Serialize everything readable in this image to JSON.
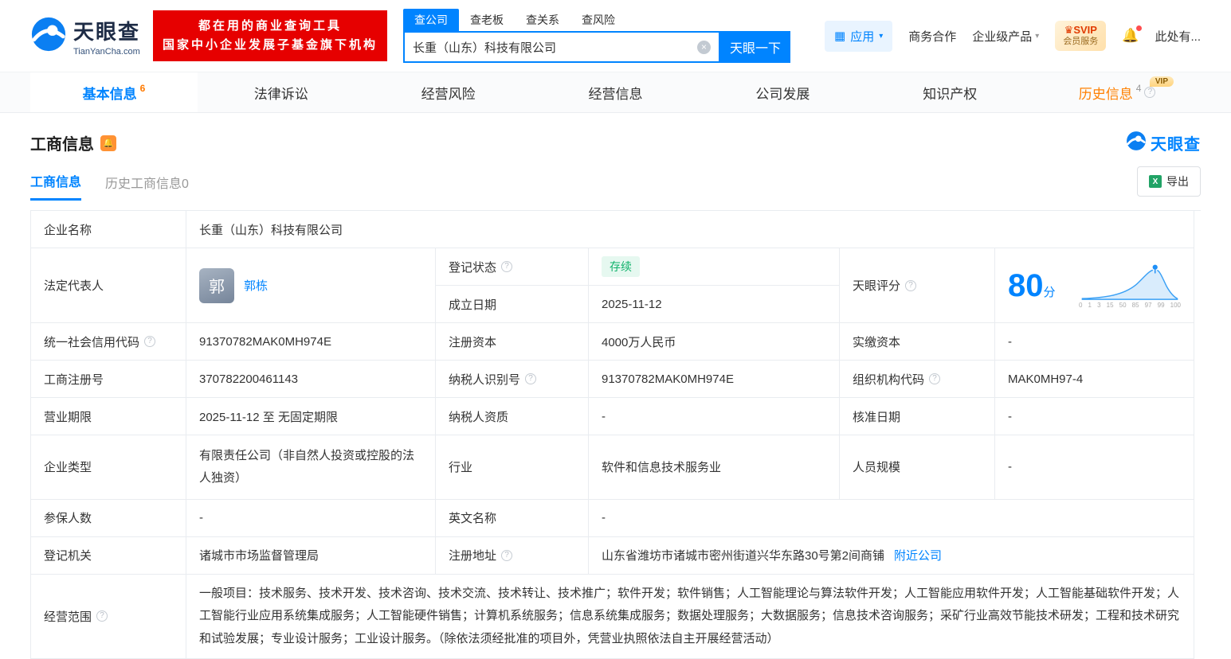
{
  "icons": {
    "clear": "×",
    "caret": "▾",
    "grid": "▦",
    "bell": "🔔",
    "crown": "♛",
    "excel": "X",
    "question": "?"
  },
  "brand": {
    "name": "天眼查",
    "domain": "TianYanCha.com"
  },
  "header": {
    "banner_line1": "都在用的商业查询工具",
    "banner_line2": "国家中小企业发展子基金旗下机构",
    "search_tabs": [
      {
        "label": "查公司"
      },
      {
        "label": "查老板"
      },
      {
        "label": "查关系"
      },
      {
        "label": "查风险"
      }
    ],
    "search_value": "长重（山东）科技有限公司",
    "search_button": "天眼一下",
    "apps_button": "应用",
    "link_cooperation": "商务合作",
    "link_enterprise": "企业级产品",
    "svip_line1": "SVIP",
    "svip_line2": "会员服务",
    "user_text": "此处有..."
  },
  "nav": {
    "tabs": [
      {
        "label": "基本信息",
        "count": "6"
      },
      {
        "label": "法律诉讼"
      },
      {
        "label": "经营风险"
      },
      {
        "label": "经营信息"
      },
      {
        "label": "公司发展"
      },
      {
        "label": "知识产权"
      },
      {
        "label": "历史信息",
        "count": "4",
        "vip": "VIP"
      }
    ]
  },
  "section": {
    "title": "工商信息",
    "subtab_active": "工商信息",
    "subtab_history": "历史工商信息0",
    "export_label": "导出"
  },
  "fields": {
    "company_name": {
      "label": "企业名称",
      "value": "长重（山东）科技有限公司"
    },
    "legal_rep": {
      "label": "法定代表人",
      "avatar_char": "郭",
      "name": "郭栋"
    },
    "reg_status": {
      "label": "登记状态",
      "value": "存续"
    },
    "establish_date": {
      "label": "成立日期",
      "value": "2025-11-12"
    },
    "tyc_score": {
      "label": "天眼评分",
      "score": "80",
      "unit": "分"
    },
    "credit_code": {
      "label": "统一社会信用代码",
      "value": "91370782MAK0MH974E"
    },
    "reg_capital": {
      "label": "注册资本",
      "value": "4000万人民币"
    },
    "paid_capital": {
      "label": "实缴资本",
      "value": "-"
    },
    "reg_number": {
      "label": "工商注册号",
      "value": "370782200461143"
    },
    "taxpayer_id": {
      "label": "纳税人识别号",
      "value": "91370782MAK0MH974E"
    },
    "org_code": {
      "label": "组织机构代码",
      "value": "MAK0MH97-4"
    },
    "business_term": {
      "label": "营业期限",
      "value": "2025-11-12 至 无固定期限"
    },
    "taxpayer_quality": {
      "label": "纳税人资质",
      "value": "-"
    },
    "approval_date": {
      "label": "核准日期",
      "value": "-"
    },
    "company_type": {
      "label": "企业类型",
      "value": "有限责任公司（非自然人投资或控股的法人独资）"
    },
    "industry": {
      "label": "行业",
      "value": "软件和信息技术服务业"
    },
    "staff_size": {
      "label": "人员规模",
      "value": "-"
    },
    "insured_count": {
      "label": "参保人数",
      "value": "-"
    },
    "english_name": {
      "label": "英文名称",
      "value": "-"
    },
    "reg_authority": {
      "label": "登记机关",
      "value": "诸城市市场监督管理局"
    },
    "reg_address": {
      "label": "注册地址",
      "value": "山东省潍坊市诸城市密州街道兴华东路30号第2间商铺",
      "link": "附近公司"
    },
    "business_scope": {
      "label": "经营范围",
      "value": "一般项目：技术服务、技术开发、技术咨询、技术交流、技术转让、技术推广；软件开发；软件销售；人工智能理论与算法软件开发；人工智能应用软件开发；人工智能基础软件开发；人工智能行业应用系统集成服务；人工智能硬件销售；计算机系统服务；信息系统集成服务；数据处理服务；大数据服务；信息技术咨询服务；采矿行业高效节能技术研发；工程和技术研究和试验发展；专业设计服务；工业设计服务。（除依法须经批准的项目外，凭营业执照依法自主开展经营活动）"
    }
  },
  "score_axis": [
    "0",
    "1",
    "3",
    "15",
    "50",
    "85",
    "97",
    "99",
    "100"
  ],
  "colors": {
    "brand_blue": "#0084ff",
    "banner_red": "#e60000",
    "status_green": "#10b26b"
  }
}
